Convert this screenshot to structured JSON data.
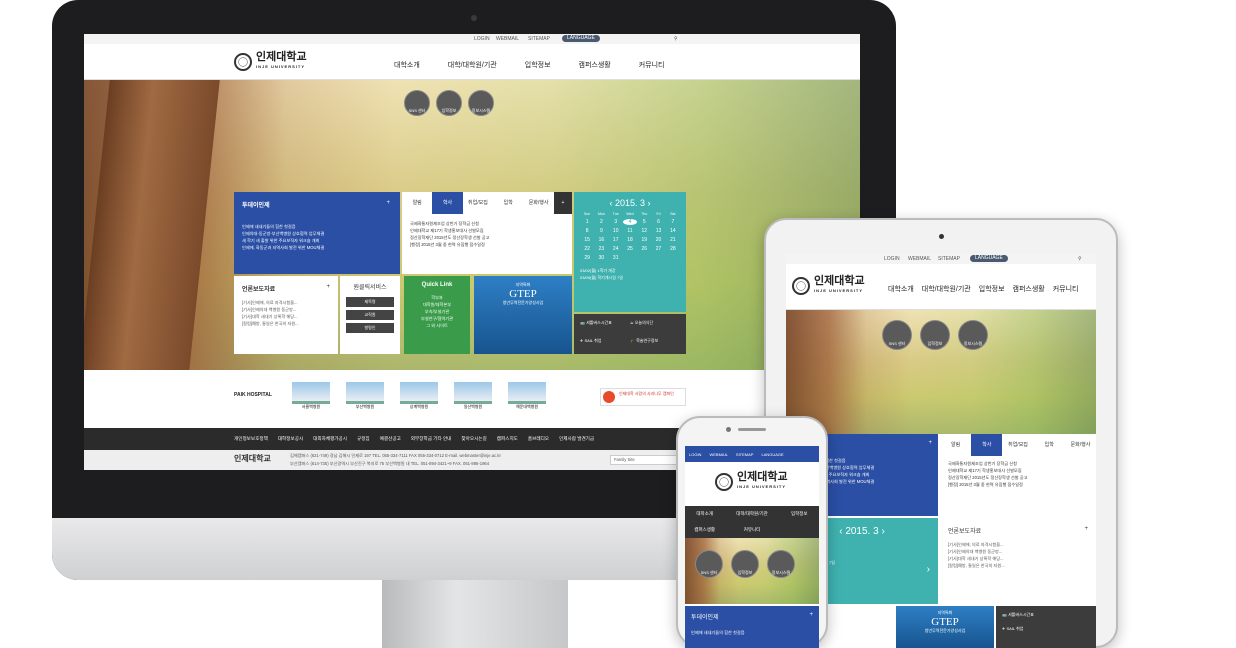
{
  "top_bar": {
    "login": "LOGIN",
    "webmail": "WEBMAIL",
    "sitemap": "SITEMAP",
    "language": "LANGUAGE"
  },
  "logo": {
    "kr": "인제대학교",
    "en": "INJE UNIVERSITY"
  },
  "gnb": [
    "대학소개",
    "대학/대학원/기관",
    "입학정보",
    "캠퍼스생활",
    "커뮤니티"
  ],
  "quick_circles": [
    {
      "label": "SNS 센터",
      "icon": "sns-icon"
    },
    {
      "label": "입학정보",
      "icon": "pencil-doc-icon"
    },
    {
      "label": "정보시스템",
      "icon": "ijis-icon",
      "text": "IJIS"
    }
  ],
  "inje_people": {
    "title": "투데이인제",
    "plus": "+",
    "items": [
      "인제에 새내기들의 힘찬 첫걸음",
      "인제의대-동군방-부산백병원 상호협력 업무체결",
      "새 학기 새 출발 위한 주요보직자 워크숍 개최",
      "인제에, 화동군과 지역사회 발전 위한 MOU체결"
    ]
  },
  "notice_tabs": {
    "tabs": [
      "알림",
      "학사",
      "취업/모집",
      "입학",
      "문화/행사"
    ],
    "active": "학사",
    "plus": "+",
    "items": [
      "국제화통자원제조업 상반기 장학금 신청",
      "인제대학교 제17기 학생홍보대사 선발모집",
      "정산장학재단 2015년도 정산장학생 선발 공고",
      "[행정] 2015년 3월 중 현역 유집행 접수일정"
    ]
  },
  "calendar": {
    "month": "2015. 3",
    "days": [
      "Sun",
      "Mon",
      "Tue",
      "Wed",
      "Thu",
      "Fri",
      "Sat"
    ],
    "dates": [
      "1",
      "2",
      "3",
      "4",
      "5",
      "6",
      "7",
      "8",
      "9",
      "10",
      "11",
      "12",
      "13",
      "14",
      "15",
      "16",
      "17",
      "18",
      "19",
      "20",
      "21",
      "22",
      "23",
      "24",
      "25",
      "26",
      "27",
      "28",
      "29",
      "30",
      "31"
    ],
    "today": "4",
    "events": [
      {
        "date": "03/02(월)",
        "text": "1학기 개강"
      },
      {
        "date": "03/09(월)",
        "text": "학기개시일 7일"
      }
    ]
  },
  "press": {
    "title": "언론보도자료",
    "plus": "+",
    "items": [
      "[기사]인제에, 의료 자격시험을...",
      "[기사]인제의대 백병원 동군방...",
      "[기사]대학 새내기 상록학 해당...",
      "[칼럼]예방, 통일은 한국의 자원..."
    ]
  },
  "one_click": {
    "title": "원클릭서비스",
    "buttons": [
      "제목명",
      "교직원",
      "발령인"
    ]
  },
  "quick_link": {
    "title": "Quick Link",
    "items": [
      "학부과",
      "대학원/대학본부",
      "부속/부설기관",
      "부설연구/협력기관",
      "그 외 사이트"
    ]
  },
  "gtep": {
    "sub": "지역특화",
    "title": "GTEP",
    "desc": "청년무역전문가양성사업"
  },
  "services": [
    {
      "icon": "bus-icon",
      "label": "셔틀버스시간표"
    },
    {
      "icon": "cup-icon",
      "label": "오늘의식단"
    },
    {
      "icon": "plane-icon",
      "label": "SAIL 취업"
    },
    {
      "icon": "grad-icon",
      "label": "학술연구정보"
    }
  ],
  "paik": {
    "title": "PAIK HOSPITAL",
    "hospitals": [
      "서울백병원",
      "부산백병원",
      "상계백병원",
      "일산백병원",
      "해운대백병원"
    ],
    "promo": "인제대학 사람의 사과나무 캠퍼인"
  },
  "footer_nav": [
    "개인정보보호정책",
    "대학정보공시",
    "대외자체평가공시",
    "규정집",
    "예결산공고",
    "외부장학금 기타 안내",
    "찾아오시는길",
    "캠퍼스지도",
    "홈브레디오",
    "인제사람 발견기금"
  ],
  "footer": {
    "campus1": "김해캠퍼스",
    "addr1": "(621-749) 경남 김해시 인제로 197  TEL. 055-334-7111  FAX 055-334-0712  E-mail. webmaster@inje.ac.kr",
    "campus2": "부산캠퍼스",
    "addr2": "(614-735) 부산광역시 부산진구 복지로 75 부산백병원 내  TEL. 051-894-3421~9  FAX. 051-895-1964",
    "family_site": "Family Site"
  },
  "colors": {
    "blue": "#2a4fa5",
    "teal": "#3fb2b0",
    "green": "#3a9b4a",
    "dark": "#2b2b2b"
  }
}
